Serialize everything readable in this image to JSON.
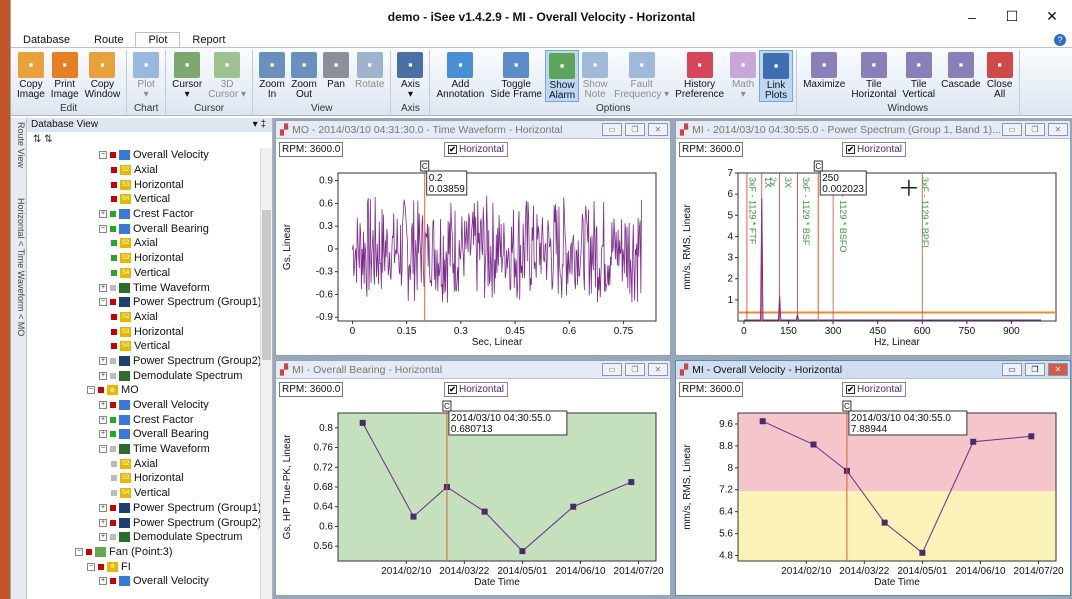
{
  "window": {
    "title": "demo - iSee v1.4.2.9 - MI - Overall Velocity - Horizontal",
    "controls": [
      "–",
      "☐",
      "✕"
    ]
  },
  "tabs": [
    "Database",
    "Route",
    "Plot",
    "Report"
  ],
  "active_tab": "Plot",
  "ribbon": [
    {
      "caption": "Edit",
      "buttons": [
        {
          "l1": "Copy",
          "l2": "Image",
          "icon": "copy-image-icon",
          "color": "#e9a23b"
        },
        {
          "l1": "Print",
          "l2": "Image",
          "icon": "print-image-icon",
          "color": "#e67e22"
        },
        {
          "l1": "Copy",
          "l2": "Window",
          "icon": "copy-window-icon",
          "color": "#e9a23b"
        }
      ]
    },
    {
      "caption": "Chart",
      "buttons": [
        {
          "l1": "Plot",
          "l2": "▾",
          "icon": "plot-icon",
          "color": "#9ab8dd",
          "disabled": true
        }
      ]
    },
    {
      "caption": "Cursor",
      "buttons": [
        {
          "l1": "Cursor",
          "l2": "▾",
          "icon": "cursor-icon",
          "color": "#7ca870"
        },
        {
          "l1": "3D",
          "l2": "Cursor ▾",
          "icon": "3d-cursor-icon",
          "color": "#9cc28e",
          "disabled": true
        }
      ]
    },
    {
      "caption": "View",
      "buttons": [
        {
          "l1": "Zoom",
          "l2": "In",
          "icon": "zoom-in-icon",
          "color": "#6b8fbf"
        },
        {
          "l1": "Zoom",
          "l2": "Out",
          "icon": "zoom-out-icon",
          "color": "#6b8fbf"
        },
        {
          "l1": "Pan",
          "l2": "",
          "icon": "pan-hand-icon",
          "color": "#8a8f99"
        },
        {
          "l1": "Rotate",
          "l2": "",
          "icon": "rotate-icon",
          "color": "#9fb3cc",
          "disabled": true
        }
      ]
    },
    {
      "caption": "Axis",
      "buttons": [
        {
          "l1": "Axis",
          "l2": "▾",
          "icon": "axis-xyz-icon",
          "color": "#4a6fa5"
        }
      ]
    },
    {
      "caption": "Options",
      "buttons": [
        {
          "l1": "Add",
          "l2": "Annotation",
          "icon": "annotation-icon",
          "color": "#4a8fd6"
        },
        {
          "l1": "Toggle",
          "l2": "Side Frame",
          "icon": "side-frame-icon",
          "color": "#5b8bc9"
        },
        {
          "l1": "Show",
          "l2": "Alarm",
          "icon": "alarm-icon",
          "color": "#5da55a",
          "selected": true
        },
        {
          "l1": "Show",
          "l2": "Note",
          "icon": "note-icon",
          "color": "#9fb9d9",
          "disabled": true
        },
        {
          "l1": "Fault",
          "l2": "Frequency ▾",
          "icon": "fault-frequency-icon",
          "color": "#9fb9d9",
          "disabled": true
        },
        {
          "l1": "History",
          "l2": "Preference",
          "icon": "history-icon",
          "color": "#d6455a"
        },
        {
          "l1": "Math",
          "l2": "▾",
          "icon": "int-diff-math-icon",
          "color": "#c9a6d9",
          "disabled": true
        },
        {
          "l1": "Link",
          "l2": "Plots",
          "icon": "link-plots-icon",
          "color": "#3f6fb0",
          "selected": true
        }
      ]
    },
    {
      "caption": "Windows",
      "buttons": [
        {
          "l1": "Maximize",
          "l2": "",
          "icon": "maximize-icon",
          "color": "#8a7fb8"
        },
        {
          "l1": "Tile",
          "l2": "Horizontal",
          "icon": "tile-horizontal-icon",
          "color": "#8a7fb8"
        },
        {
          "l1": "Tile",
          "l2": "Vertical",
          "icon": "tile-vertical-icon",
          "color": "#8a7fb8"
        },
        {
          "l1": "Cascade",
          "l2": "",
          "icon": "cascade-icon",
          "color": "#8a7fb8"
        },
        {
          "l1": "Close",
          "l2": "All",
          "icon": "close-all-icon",
          "color": "#d04a4a"
        }
      ]
    }
  ],
  "side_tabs": [
    "Route View",
    "Horizontal < Time Waveform < MO"
  ],
  "tree": {
    "header": "Database View",
    "pin": "▾ ‡",
    "tools": "⇅ ⇅",
    "nodes": [
      {
        "level": 4,
        "pm": "−",
        "sq": "#c00",
        "icon": "#3a7ad6",
        "label": "Overall Velocity"
      },
      {
        "level": 5,
        "sq": "#c00",
        "icon": "#e6b800",
        "label": "Axial",
        "glyph": "S2"
      },
      {
        "level": 5,
        "sq": "#c00",
        "icon": "#e6b800",
        "label": "Horizontal",
        "glyph": "S3"
      },
      {
        "level": 5,
        "sq": "#c00",
        "icon": "#e6b800",
        "label": "Vertical",
        "glyph": "S4"
      },
      {
        "level": 4,
        "pm": "+",
        "sq": "#2a2",
        "icon": "#3a7ad6",
        "label": "Crest Factor"
      },
      {
        "level": 4,
        "pm": "−",
        "sq": "#2a2",
        "icon": "#3a7ad6",
        "label": "Overall Bearing"
      },
      {
        "level": 5,
        "sq": "#2a2",
        "icon": "#e6b800",
        "label": "Axial",
        "glyph": "S2"
      },
      {
        "level": 5,
        "sq": "#2a2",
        "icon": "#e6b800",
        "label": "Horizontal",
        "glyph": "S3"
      },
      {
        "level": 5,
        "sq": "#2a2",
        "icon": "#e6b800",
        "label": "Vertical",
        "glyph": "S4"
      },
      {
        "level": 4,
        "pm": "+",
        "sq": "#bbb",
        "icon": "#2e6b2e",
        "label": "Time Waveform"
      },
      {
        "level": 4,
        "pm": "−",
        "sq": "#c00",
        "icon": "#1f3f6e",
        "label": "Power Spectrum (Group1)"
      },
      {
        "level": 5,
        "sq": "#c00",
        "icon": "#e6b800",
        "label": "Axial",
        "glyph": "S2"
      },
      {
        "level": 5,
        "sq": "#c00",
        "icon": "#e6b800",
        "label": "Horizontal",
        "glyph": "S3"
      },
      {
        "level": 5,
        "sq": "#c00",
        "icon": "#e6b800",
        "label": "Vertical",
        "glyph": "S4"
      },
      {
        "level": 4,
        "pm": "+",
        "sq": "#bbb",
        "icon": "#1f3f6e",
        "label": "Power Spectrum (Group2)"
      },
      {
        "level": 4,
        "pm": "+",
        "sq": "#bbb",
        "icon": "#2e6b2e",
        "label": "Demodulate Spectrum"
      },
      {
        "level": 3,
        "pm": "−",
        "sq": "#c00",
        "icon": "#e6b800",
        "label": "MO",
        "glyph": "⚙"
      },
      {
        "level": 4,
        "pm": "+",
        "sq": "#c00",
        "icon": "#3a7ad6",
        "label": "Overall Velocity"
      },
      {
        "level": 4,
        "pm": "+",
        "sq": "#2a2",
        "icon": "#3a7ad6",
        "label": "Crest Factor"
      },
      {
        "level": 4,
        "pm": "+",
        "sq": "#2a2",
        "icon": "#3a7ad6",
        "label": "Overall Bearing"
      },
      {
        "level": 4,
        "pm": "−",
        "sq": "#bbb",
        "icon": "#2e6b2e",
        "label": "Time Waveform"
      },
      {
        "level": 5,
        "sq": "#bbb",
        "icon": "#e6b800",
        "label": "Axial",
        "glyph": "S2"
      },
      {
        "level": 5,
        "sq": "#bbb",
        "icon": "#e6b800",
        "label": "Horizontal",
        "glyph": "S3"
      },
      {
        "level": 5,
        "sq": "#bbb",
        "icon": "#e6b800",
        "label": "Vertical",
        "glyph": "S4"
      },
      {
        "level": 4,
        "pm": "+",
        "sq": "#c00",
        "icon": "#1f3f6e",
        "label": "Power Spectrum (Group1)"
      },
      {
        "level": 4,
        "pm": "+",
        "sq": "#c00",
        "icon": "#1f3f6e",
        "label": "Power Spectrum (Group2)"
      },
      {
        "level": 4,
        "pm": "+",
        "sq": "#bbb",
        "icon": "#2e6b2e",
        "label": "Demodulate Spectrum"
      },
      {
        "level": 2,
        "pm": "−",
        "sq": "#c00",
        "icon": "#6aa84f",
        "label": "Fan (Point:3)"
      },
      {
        "level": 3,
        "pm": "−",
        "sq": "#c00",
        "icon": "#e6b800",
        "label": "FI",
        "glyph": "⚙"
      },
      {
        "level": 4,
        "pm": "+",
        "sq": "#c00",
        "icon": "#3a7ad6",
        "label": "Overall Velocity"
      }
    ]
  },
  "panels": {
    "tw": {
      "title": "MO - 2014/03/10 04:31:30.0 - Time Waveform - Horizontal",
      "rpm": "RPM: 3600.0",
      "check": "Horizontal",
      "ylabel": "Gs, Linear",
      "xlabel": "Sec, Linear",
      "cursor_label": "C",
      "readout": [
        "0.2",
        "0.03859"
      ]
    },
    "ps": {
      "title": "MI - 2014/03/10 04:30:55.0 - Power Spectrum (Group 1, Band 1)...",
      "rpm": "RPM: 3600.0",
      "check": "Horizontal",
      "ylabel": "mm/s, RMS, Linear",
      "xlabel": "Hz, Linear",
      "cursor_label": "C",
      "readout": [
        "250",
        "0.002023"
      ],
      "fault_labels": [
        "3xF - 1129 * FTF",
        "1X",
        "2x",
        "3X",
        "3xF - 1129 * BSF",
        "3xF - 1129 * BSFO",
        "3xF - 1129 * BPFI"
      ]
    },
    "ob": {
      "title": "MI - Overall Bearing - Horizontal",
      "rpm": "RPM: 3600.0",
      "check": "Horizontal",
      "ylabel": "Gs, HP True-PK, Linear",
      "xlabel": "Date Time",
      "cursor_label": "C",
      "readout": [
        "2014/03/10 04:30:55.0",
        "0.680713"
      ]
    },
    "ov": {
      "title": "MI - Overall Velocity - Horizontal",
      "rpm": "RPM: 3600.0",
      "check": "Horizontal",
      "ylabel": "mm/s, RMS, Linear",
      "xlabel": "Date Time",
      "cursor_label": "C",
      "readout": [
        "2014/03/10 04:30:55.0",
        "7.88944"
      ]
    }
  },
  "chart_data": [
    {
      "type": "line",
      "panel": "tw",
      "xlabel": "Sec, Linear",
      "ylabel": "Gs, Linear",
      "xlim": [
        -0.04,
        0.84
      ],
      "ylim": [
        -0.95,
        1.0
      ],
      "xticks": [
        0,
        0.15,
        0.3,
        0.45,
        0.6,
        0.75
      ],
      "yticks": [
        0.9,
        0.6,
        0.3,
        0,
        -0.3,
        -0.6,
        -0.9
      ],
      "cursor_x": 0.2,
      "color": "#7b2c8c",
      "note": "vibration waveform, amplitude about ±0.7 Gs"
    },
    {
      "type": "line",
      "panel": "ps",
      "xlabel": "Hz, Linear",
      "ylabel": "mm/s, RMS, Linear",
      "xlim": [
        -20,
        1050
      ],
      "ylim": [
        0,
        7
      ],
      "xticks": [
        0,
        150,
        300,
        450,
        600,
        750,
        900
      ],
      "yticks": [
        1,
        2,
        3,
        4,
        5,
        6,
        7
      ],
      "cursor_x": 250,
      "alarm": 0.4,
      "peaks": [
        {
          "x": 60,
          "y": 5.8
        },
        {
          "x": 120,
          "y": 1.2
        },
        {
          "x": 180,
          "y": 0.3
        }
      ],
      "color": "#7b2c8c"
    },
    {
      "type": "line",
      "panel": "ob",
      "xlabel": "Date Time",
      "ylabel": "Gs, HP True-PK, Linear",
      "ylim": [
        0.53,
        0.83
      ],
      "yticks": [
        0.8,
        0.76,
        0.72,
        0.68,
        0.64,
        0.6,
        0.56
      ],
      "x_ticklabels": [
        "2014/02/10",
        "2014/03/22",
        "2014/05/01",
        "2014/06/10",
        "2014/07/20"
      ],
      "x": [
        "2014/01/11",
        "2014/02/15",
        "2014/03/10",
        "2014/04/05",
        "2014/05/01",
        "2014/06/05",
        "2014/07/15"
      ],
      "values": [
        0.81,
        0.62,
        0.68,
        0.63,
        0.55,
        0.64,
        0.69
      ],
      "cursor_x": "2014/03/10",
      "color": "#6a2c8c",
      "background": "#c5e0bd"
    },
    {
      "type": "line",
      "panel": "ov",
      "xlabel": "Date Time",
      "ylabel": "mm/s, RMS, Linear",
      "ylim": [
        4.6,
        10.0
      ],
      "yticks": [
        9.6,
        8.8,
        8.0,
        7.2,
        6.4,
        5.6,
        4.8
      ],
      "x_ticklabels": [
        "2014/02/10",
        "2014/03/22",
        "2014/05/01",
        "2014/06/10",
        "2014/07/20"
      ],
      "x": [
        "2014/01/11",
        "2014/02/15",
        "2014/03/10",
        "2014/04/05",
        "2014/05/01",
        "2014/06/05",
        "2014/07/15"
      ],
      "values": [
        9.7,
        8.85,
        7.89,
        6.0,
        4.9,
        8.95,
        9.15
      ],
      "cursor_x": "2014/03/10",
      "color": "#6a2c8c",
      "bands": [
        {
          "from": 7.15,
          "to": 10.0,
          "color": "#f4c6cb"
        },
        {
          "from": 4.6,
          "to": 7.15,
          "color": "#fbf2b8"
        }
      ]
    }
  ]
}
